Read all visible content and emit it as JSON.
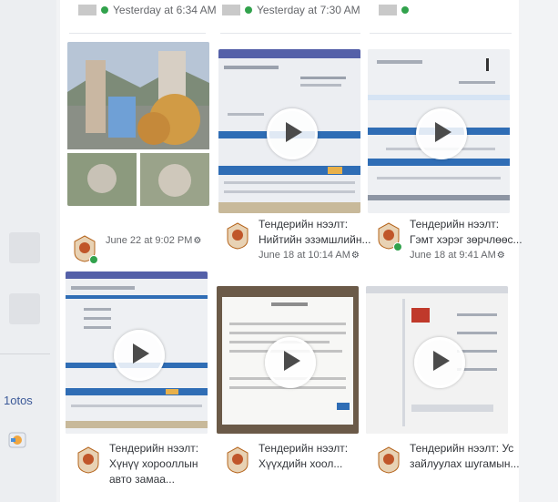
{
  "sidebar": {
    "photos_label": "1otos"
  },
  "top_row": [
    {
      "time": "Yesterday at 6:34 AM"
    },
    {
      "time": "Yesterday at 7:30 AM"
    },
    {
      "time": ""
    }
  ],
  "videos": [
    {
      "title": "",
      "date": "June 22 at 9:02 PM"
    },
    {
      "title": "Тендерийн нээлт: Нийтийн эзэмшлийн...",
      "date": "June 18 at 10:14 AM"
    },
    {
      "title": "Тендерийн нээлт: Гэмт хэрэг зөрчлөөс...",
      "date": "June 18 at 9:41 AM"
    },
    {
      "title": "Тендерийн нээлт: Хүнүү хорооллын авто замаа...",
      "date": ""
    },
    {
      "title": "Тендерийн нээлт: Хүүхдийн хоол...",
      "date": ""
    },
    {
      "title": "Тендерийн нээлт: Ус зайлуулах шугамын...",
      "date": ""
    }
  ],
  "colors": {
    "online": "#31a24c",
    "link": "#3b5998",
    "accent_blue": "#2f6db5"
  }
}
